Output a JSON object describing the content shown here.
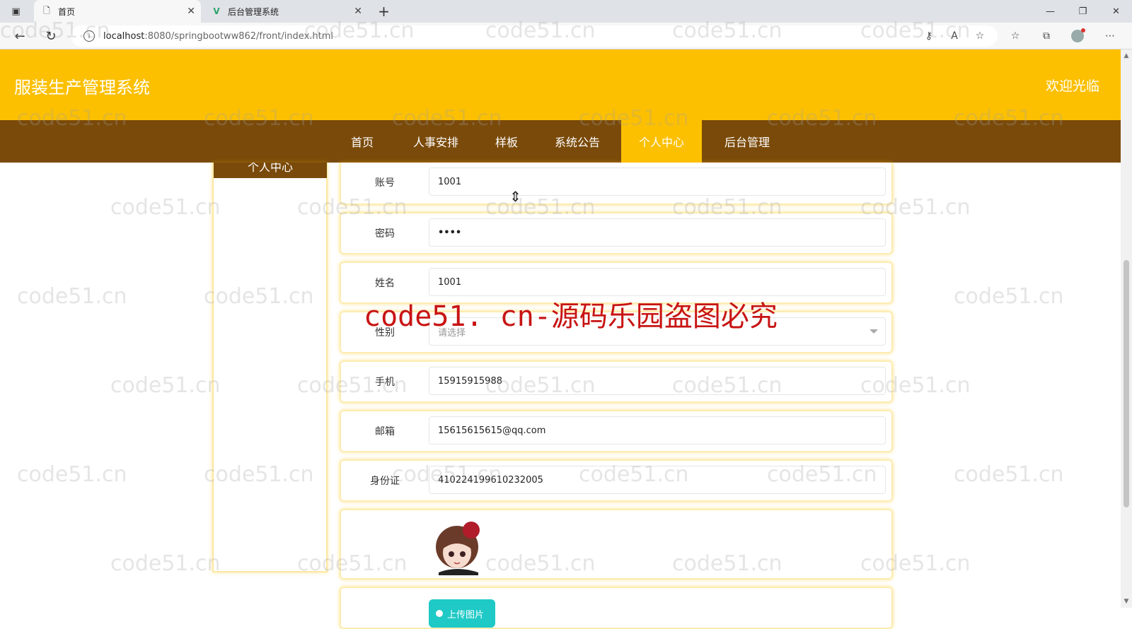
{
  "browser": {
    "tabs": [
      {
        "title": "首页",
        "active": true
      },
      {
        "title": "后台管理系统",
        "active": false
      }
    ],
    "url_host": "localhost",
    "url_path": ":8080/springbootww862/front/index.html"
  },
  "header": {
    "title": "服装生产管理系统",
    "welcome": "欢迎光临"
  },
  "nav": {
    "items": [
      "首页",
      "人事安排",
      "样板",
      "系统公告",
      "个人中心",
      "后台管理"
    ],
    "active_index": 4
  },
  "sidebar": {
    "title": "个人中心"
  },
  "form": {
    "account_label": "账号",
    "account_value": "1001",
    "password_label": "密码",
    "password_value": "••••",
    "name_label": "姓名",
    "name_value": "1001",
    "gender_label": "性别",
    "gender_placeholder": "请选择",
    "phone_label": "手机",
    "phone_value": "15915915988",
    "email_label": "邮箱",
    "email_value": "15615615615@qq.com",
    "idcard_label": "身份证",
    "idcard_value": "410224199610232005",
    "upload_label": "上传图片"
  },
  "watermark": {
    "text": "code51.cn",
    "banner": "code51. cn-源码乐园盗图必究"
  },
  "colors": {
    "header": "#fcc000",
    "nav": "#7a4a0a",
    "banner": "#c81414",
    "upload": "#1fc9c6"
  }
}
